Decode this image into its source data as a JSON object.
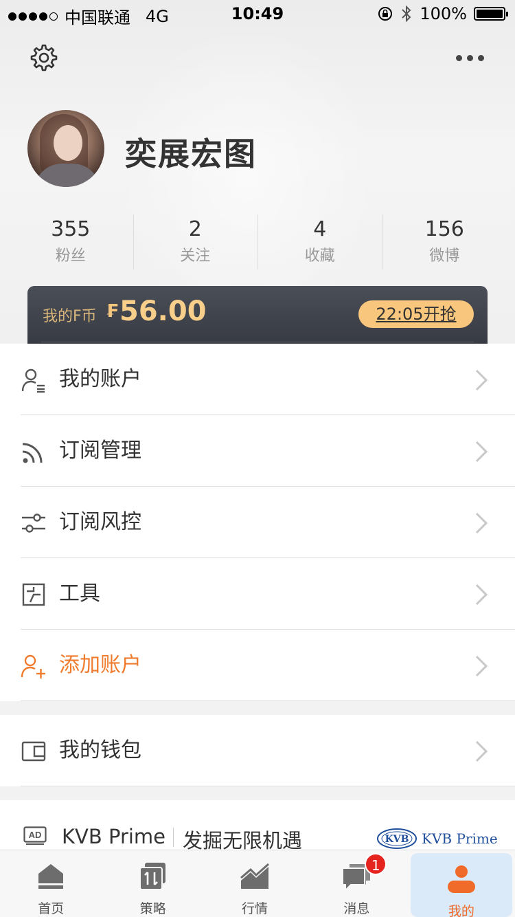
{
  "status_bar": {
    "carrier": "中国联通",
    "network": "4G",
    "time": "10:49",
    "battery": "100%"
  },
  "profile": {
    "username": "奕展宏图",
    "stats": [
      {
        "value": "355",
        "label": "粉丝"
      },
      {
        "value": "2",
        "label": "关注"
      },
      {
        "value": "4",
        "label": "收藏"
      },
      {
        "value": "156",
        "label": "微博"
      }
    ]
  },
  "coin": {
    "label": "我的F币",
    "symbol": "₣",
    "amount": "56.00",
    "button": "22:05开抢"
  },
  "menu": {
    "items": [
      {
        "label": "我的账户",
        "icon": "account-icon"
      },
      {
        "label": "订阅管理",
        "icon": "rss-icon"
      },
      {
        "label": "订阅风控",
        "icon": "sliders-icon"
      },
      {
        "label": "工具",
        "icon": "tool-icon"
      },
      {
        "label": "添加账户",
        "icon": "add-user-icon",
        "accent": "#f07b2c"
      }
    ],
    "wallet": {
      "label": "我的钱包",
      "icon": "wallet-icon"
    }
  },
  "ad": {
    "badge": "AD",
    "title": "KVB Prime",
    "slogan": "发掘无限机遇",
    "logo_text": "KVB Prime",
    "logo_mark": "KVB"
  },
  "tabs": [
    {
      "label": "首页",
      "icon": "home-icon"
    },
    {
      "label": "策略",
      "icon": "strategy-icon"
    },
    {
      "label": "行情",
      "icon": "market-icon"
    },
    {
      "label": "消息",
      "icon": "message-icon",
      "badge": "1"
    },
    {
      "label": "我的",
      "icon": "profile-icon",
      "active": true
    }
  ],
  "colors": {
    "accent": "#f07b2c",
    "coin": "#f7cf8a",
    "card": "#3b3e46",
    "badge": "#e5231f"
  }
}
